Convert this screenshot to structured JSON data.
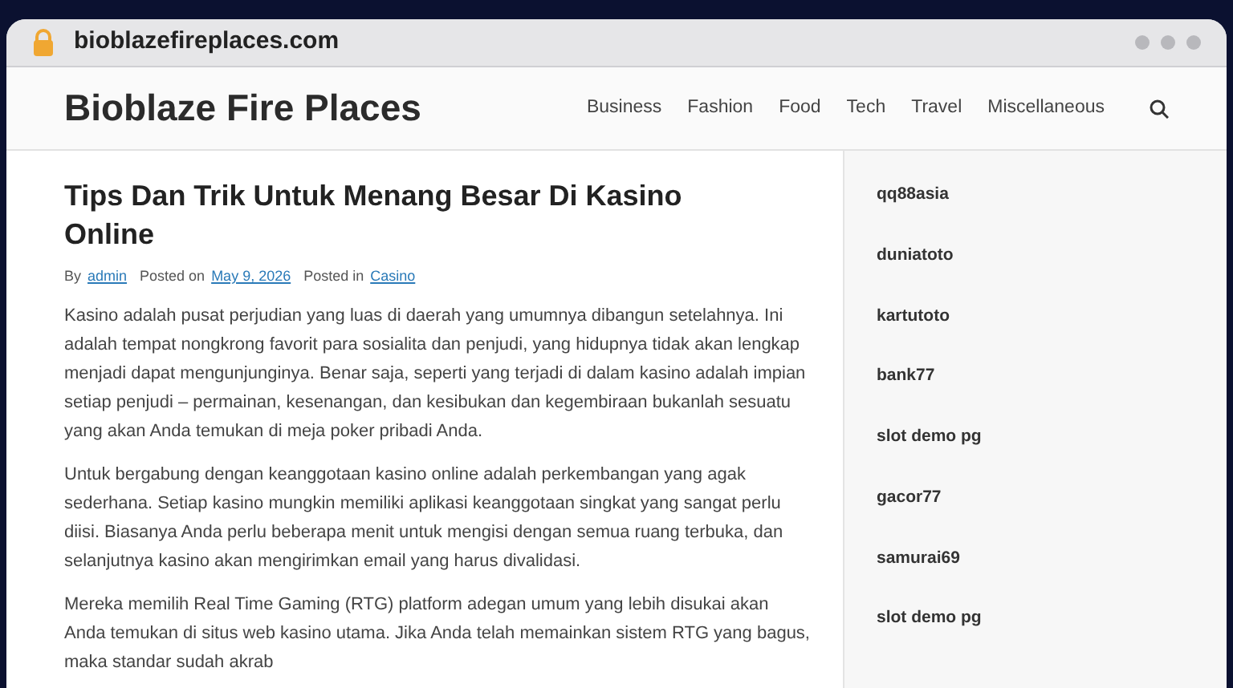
{
  "browser": {
    "url": "bioblazefireplaces.com"
  },
  "site": {
    "title": "Bioblaze Fire Places"
  },
  "nav": [
    {
      "label": "Business"
    },
    {
      "label": "Fashion"
    },
    {
      "label": "Food"
    },
    {
      "label": "Tech"
    },
    {
      "label": "Travel"
    },
    {
      "label": "Miscellaneous"
    }
  ],
  "post": {
    "title": "Tips Dan Trik Untuk Menang Besar Di Kasino Online",
    "meta": [
      {
        "label": "By",
        "link": "admin"
      },
      {
        "label": "Posted on",
        "link": "May 9, 2026"
      },
      {
        "label": "Posted in",
        "link": "Casino"
      }
    ],
    "paragraphs": [
      "Kasino adalah pusat perjudian yang luas di daerah yang umumnya dibangun setelahnya. Ini adalah tempat nongkrong favorit para sosialita dan penjudi, yang hidupnya tidak akan lengkap menjadi dapat mengunjunginya. Benar saja, seperti yang terjadi di dalam kasino adalah impian setiap penjudi – permainan, kesenangan, dan kesibukan dan kegembiraan bukanlah sesuatu yang akan Anda temukan di meja poker pribadi Anda.",
      "Untuk bergabung dengan keanggotaan kasino online adalah perkembangan yang agak sederhana. Setiap kasino mungkin memiliki aplikasi keanggotaan singkat yang sangat perlu diisi. Biasanya Anda perlu beberapa menit untuk mengisi dengan semua ruang terbuka, dan selanjutnya kasino akan mengirimkan email yang harus divalidasi.",
      "Mereka memilih Real Time Gaming (RTG) platform adegan umum yang lebih disukai akan Anda temukan di situs web kasino utama. Jika Anda telah memainkan sistem RTG yang bagus, maka standar sudah akrab"
    ]
  },
  "sidebar": {
    "links": [
      "qq88asia",
      "duniatoto",
      "kartutoto",
      "bank77",
      "slot demo pg",
      "gacor77",
      "samurai69",
      "slot demo pg"
    ]
  }
}
